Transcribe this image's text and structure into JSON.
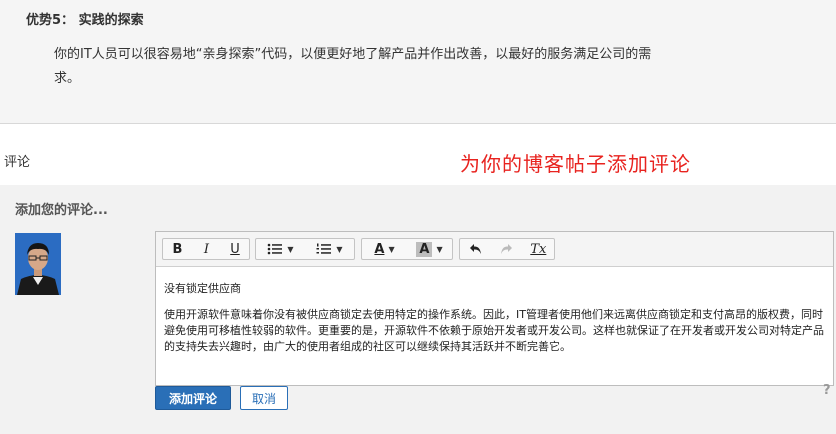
{
  "article": {
    "advantage_title": "优势5： 实践的探索",
    "advantage_text": "你的IT人员可以很容易地“亲身探索”代码，以便更好地了解产品并作出改善，以最好的服务满足公司的需求。"
  },
  "comments": {
    "section_label": "评论",
    "annotation": "为你的博客帖子添加评论",
    "add_heading": "添加您的评论...",
    "avatar_icon": "user-avatar",
    "toolbar": {
      "bold": "B",
      "italic": "I",
      "underline": "U",
      "bullet_list_icon": "bullet-list-icon",
      "numbered_list_icon": "numbered-list-icon",
      "text_color": "A",
      "highlight_color": "A",
      "undo_icon": "undo-icon",
      "redo_icon": "redo-icon",
      "clear_format": "Tx"
    },
    "editor": {
      "line1": "没有锁定供应商",
      "paragraph": "使用开源软件意味着你没有被供应商锁定去使用特定的操作系统。因此，IT管理者使用他们来远离供应商锁定和支付高昂的版权费，同时避免使用可移植性较弱的软件。更重要的是，开源软件不依赖于原始开发者或开发公司。这样也就保证了在开发者或开发公司对特定产品的支持失去兴趣时，由广大的使用者组成的社区可以继续保持其活跃并不断完善它。"
    },
    "submit_label": "添加评论",
    "cancel_label": "取消",
    "help_label": "?"
  }
}
